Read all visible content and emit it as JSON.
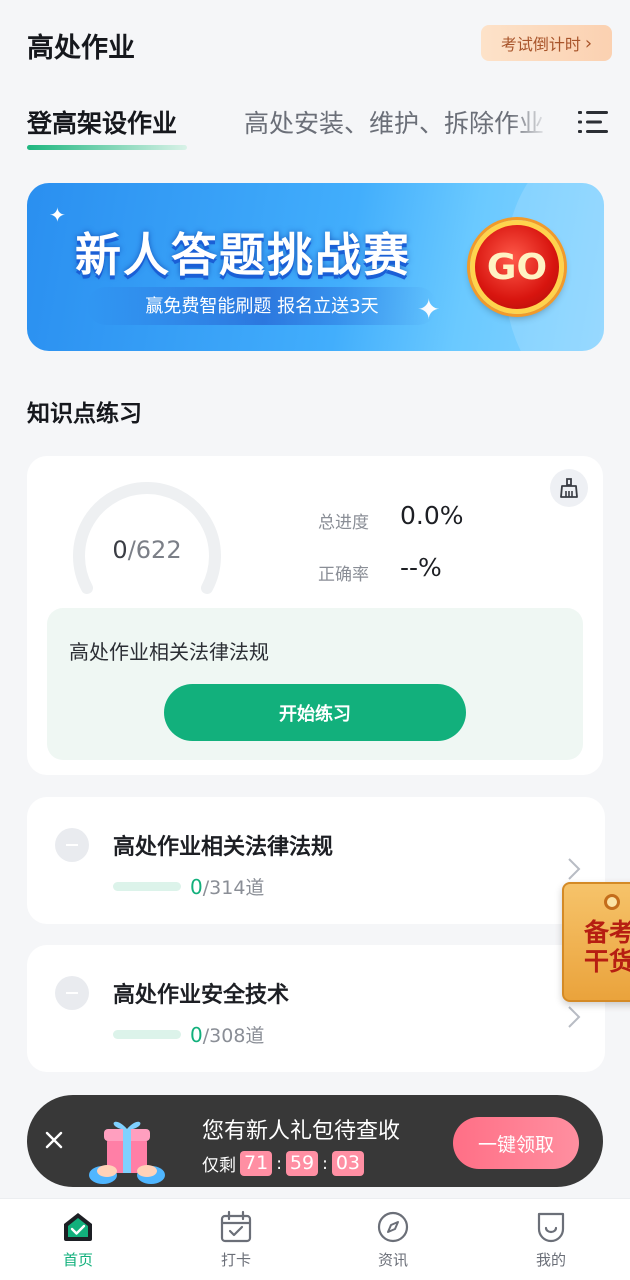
{
  "header": {
    "title": "高处作业",
    "countdown_label": "考试倒计时",
    "countdown_chevron": "›"
  },
  "tabs": [
    {
      "label": "登高架设作业",
      "active": true
    },
    {
      "label": "高处安装、维护、拆除作业",
      "active": false
    }
  ],
  "banner": {
    "title": "新人答题挑战赛",
    "subtitle": "赢免费智能刷题  报名立送3天",
    "go_label": "GO"
  },
  "section_title": "知识点练习",
  "progress": {
    "done": "0",
    "total": "/622",
    "fraction_completed": 0.0,
    "total_progress_label": "总进度",
    "total_progress_value": "0.0%",
    "accuracy_label": "正确率",
    "accuracy_value": "--%",
    "current_chapter": "高处作业相关法律法规",
    "start_label": "开始练习"
  },
  "chapters": [
    {
      "title": "高处作业相关法律法规",
      "done": "0",
      "total": "/314道"
    },
    {
      "title": "高处作业安全技术",
      "done": "0",
      "total": "/308道"
    }
  ],
  "float_tag": {
    "text": "备考干货"
  },
  "gift": {
    "title": "您有新人礼包待查收",
    "remaining_label": "仅剩",
    "hours": "71",
    "minutes": "59",
    "seconds": "03",
    "separator": ":",
    "claim_label": "一键领取"
  },
  "nav": [
    {
      "label": "首页",
      "icon": "home-icon",
      "active": true
    },
    {
      "label": "打卡",
      "icon": "calendar-check-icon",
      "active": false
    },
    {
      "label": "资讯",
      "icon": "compass-icon",
      "active": false
    },
    {
      "label": "我的",
      "icon": "profile-icon",
      "active": false
    }
  ],
  "colors": {
    "accent": "#12b07c",
    "countdown_text": "#a8542a",
    "gift_pink": "#ff6f86"
  }
}
